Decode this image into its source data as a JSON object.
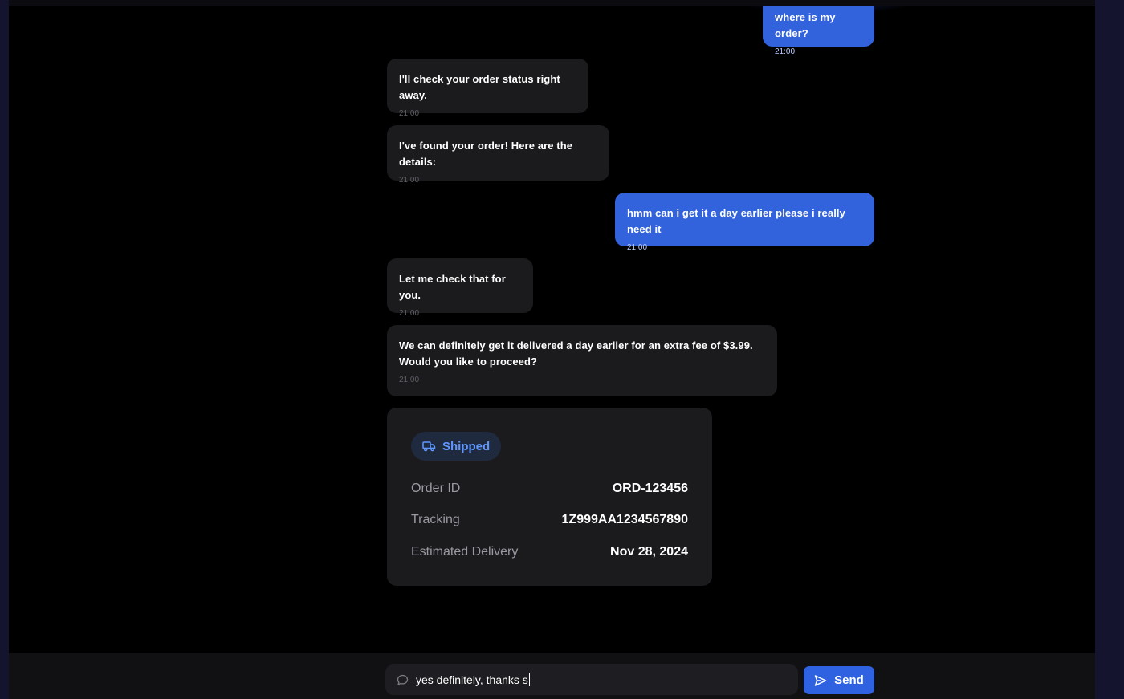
{
  "messages": [
    {
      "sender": "user",
      "text": "where is my order?",
      "time": "21:00"
    },
    {
      "sender": "bot",
      "text": "I'll check your order status right away.",
      "time": "21:00"
    },
    {
      "sender": "bot",
      "text": "I've found your order! Here are the details:",
      "time": "21:00"
    },
    {
      "sender": "user",
      "text": "hmm can i get it a day earlier please i really need it",
      "time": "21:00"
    },
    {
      "sender": "bot",
      "text": "Let me check that for you.",
      "time": "21:00"
    },
    {
      "sender": "bot",
      "text": "We can definitely get it delivered a day earlier for an extra fee of $3.99. Would you like to proceed?",
      "time": "21:00"
    }
  ],
  "order_card": {
    "status": "Shipped",
    "status_icon": "truck-icon",
    "rows": [
      {
        "label": "Order ID",
        "value": "ORD-123456"
      },
      {
        "label": "Tracking",
        "value": "1Z999AA1234567890"
      },
      {
        "label": "Estimated Delivery",
        "value": "Nov 28, 2024"
      }
    ]
  },
  "composer": {
    "icon": "chat-bubble-icon",
    "value": "yes definitely, thanks s",
    "send_label": "Send",
    "send_icon": "send-icon"
  },
  "colors": {
    "user_bubble": "#3263dd",
    "bot_bubble": "#1b1b1e",
    "status_accent": "#5f97ff",
    "send_button": "#2f62e0",
    "background": "#000000"
  }
}
